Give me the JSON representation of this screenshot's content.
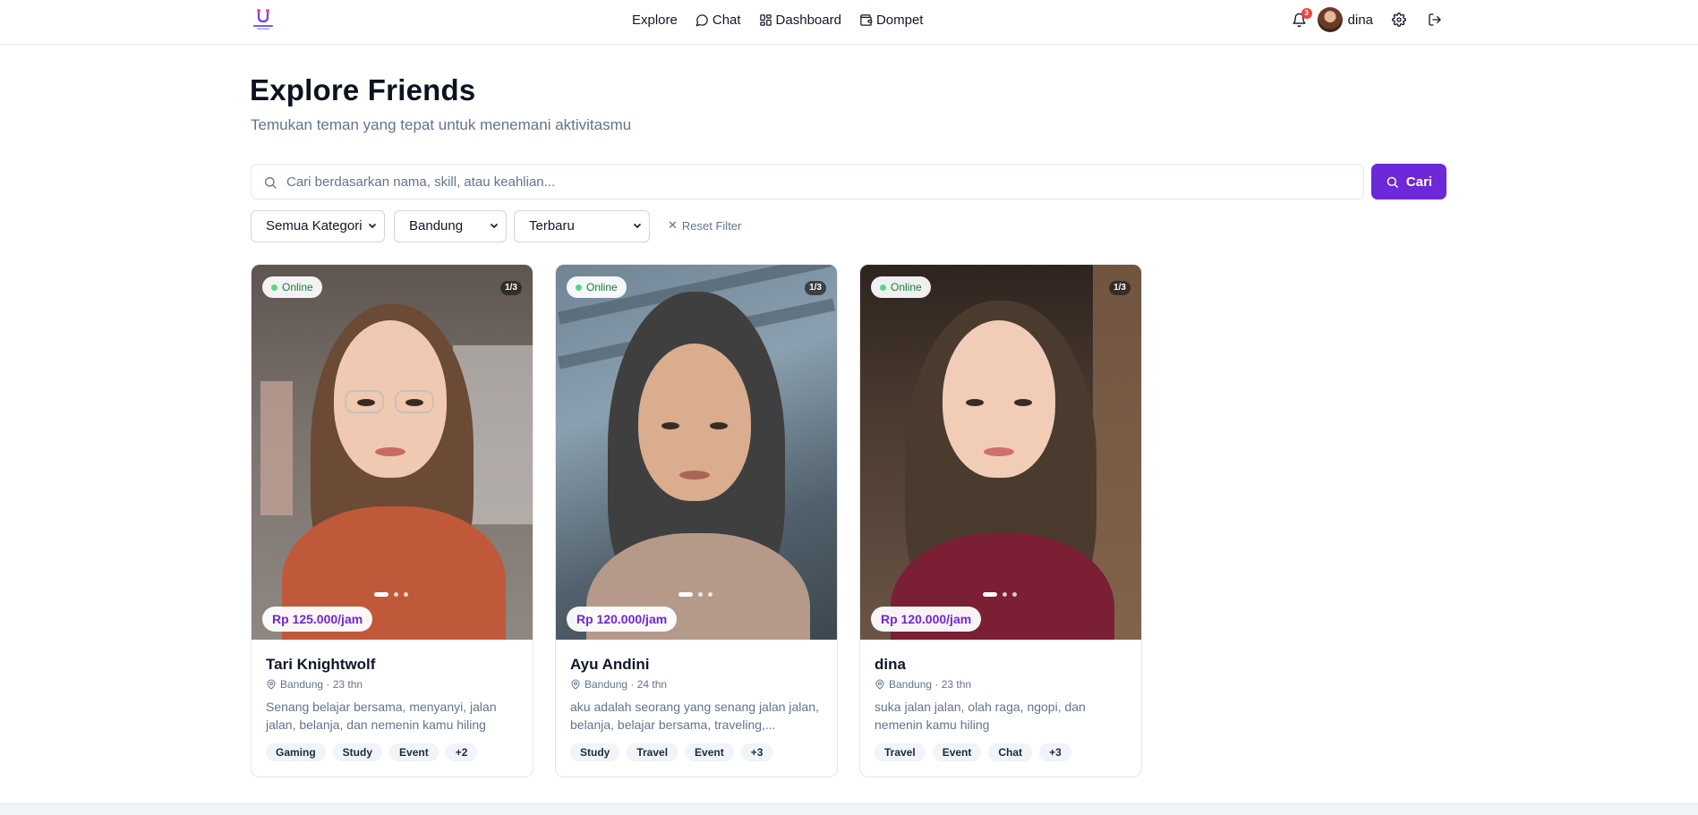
{
  "nav": {
    "links": [
      {
        "label": "Explore",
        "icon": ""
      },
      {
        "label": "Chat",
        "icon": "message-circle-icon"
      },
      {
        "label": "Dashboard",
        "icon": "layout-grid-icon"
      },
      {
        "label": "Dompet",
        "icon": "wallet-icon"
      }
    ],
    "notification_count": "3",
    "username": "dina"
  },
  "header": {
    "title": "Explore Friends",
    "subtitle": "Temukan teman yang tepat untuk menemani aktivitasmu"
  },
  "search": {
    "placeholder": "Cari berdasarkan nama, skill, atau keahlian...",
    "value": "",
    "button_label": "Cari"
  },
  "filters": {
    "category": "Semua Kategori",
    "city": "Bandung",
    "sort": "Terbaru",
    "reset_label": "Reset Filter"
  },
  "cards": [
    {
      "name": "Tari Knightwolf",
      "meta": "Bandung · 23 thn",
      "bio": "Senang belajar bersama, menyanyi, jalan jalan, belanja, dan nemenin kamu hiling",
      "status": "Online",
      "photo_counter": "1/3",
      "price": "Rp 125.000/jam",
      "tags": [
        "Gaming",
        "Study",
        "Event",
        "+2"
      ]
    },
    {
      "name": "Ayu Andini",
      "meta": "Bandung · 24 thn",
      "bio": "aku adalah seorang yang senang jalan jalan, belanja, belajar bersama, traveling,...",
      "status": "Online",
      "photo_counter": "1/3",
      "price": "Rp 120.000/jam",
      "tags": [
        "Study",
        "Travel",
        "Event",
        "+3"
      ]
    },
    {
      "name": "dina",
      "meta": "Bandung · 23 thn",
      "bio": "suka jalan jalan, olah raga, ngopi, dan nemenin kamu hiling",
      "status": "Online",
      "photo_counter": "1/3",
      "price": "Rp 120.000/jam",
      "tags": [
        "Travel",
        "Event",
        "Chat",
        "+3"
      ]
    }
  ],
  "colors": {
    "accent": "#6d28d9",
    "online": "#4ade80",
    "badge": "#ef4444"
  }
}
